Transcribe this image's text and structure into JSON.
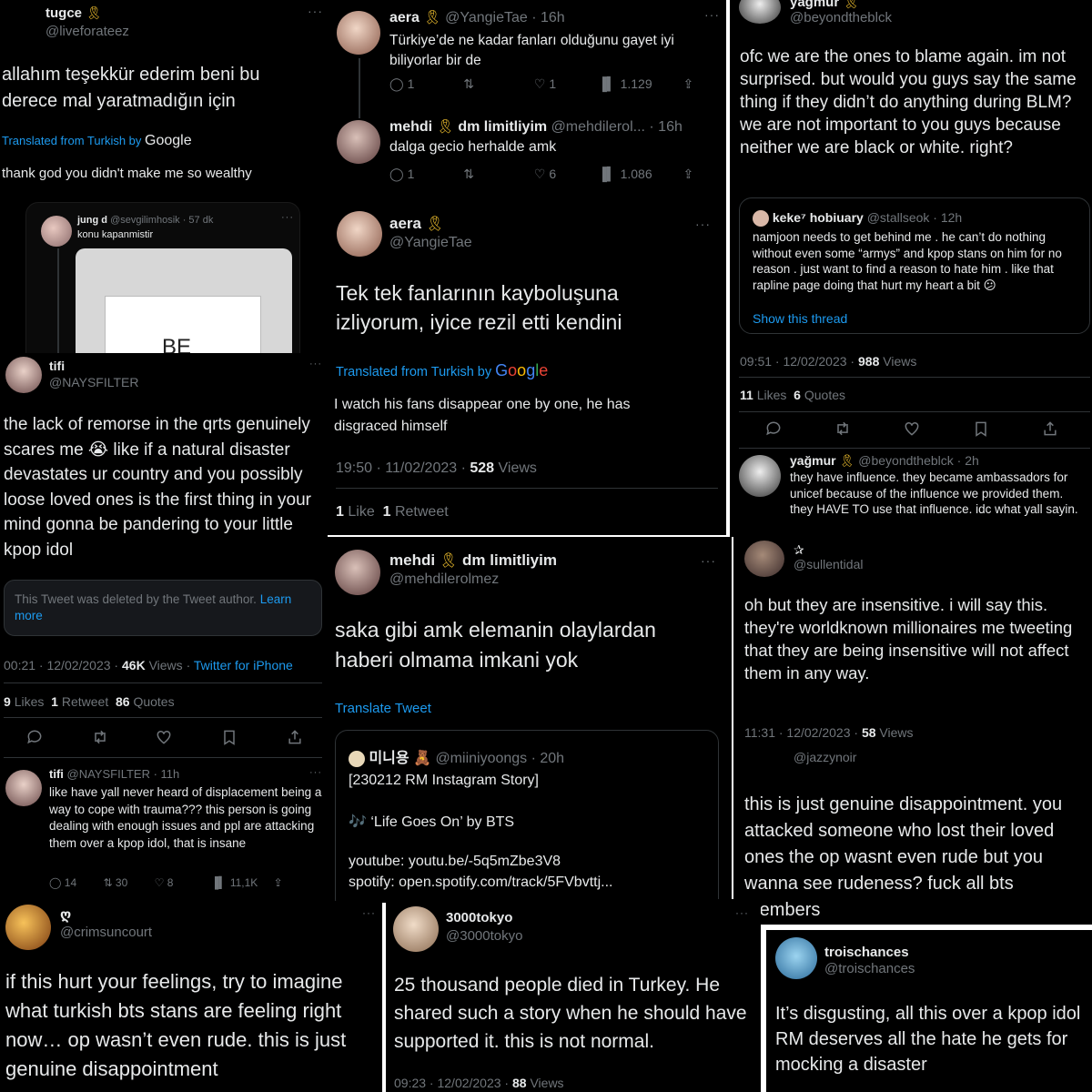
{
  "p1": {
    "name": "tugce",
    "handle": "@liveforateez",
    "text": "allahım teşekkür ederim beni bu derece mal yaratmadığın için",
    "translated_prefix": "Translated from Turkish by",
    "google": "Google",
    "translation": "thank god you didn't make me so wealthy",
    "quote_name": "jung d",
    "quote_handle": "@sevgilimhosik · 57 dk",
    "quote_text": "konu kapanmistir",
    "image_text": "BE"
  },
  "p2": {
    "name": "aera",
    "handle": "@YangieTae · 16h",
    "text": "Türkiye’de ne kadar fanları olduğunu gayet iyi biliyorlar bir de",
    "replies": "1",
    "likes": "1",
    "views": "1.129",
    "reply_name": "mehdi",
    "reply_name_tail": "dm limitliyim",
    "reply_handle": "@mehdilerol... · 16h",
    "reply_text": "dalga gecio herhalde amk",
    "reply_replies": "1",
    "reply_likes": "6",
    "reply_views": "1.086",
    "main_name": "aera",
    "main_handle": "@YangieTae",
    "main_text": "Tek tek fanlarının kayboluşuna izliyorum, iyice rezil etti kendini",
    "translated_prefix": "Translated from Turkish by",
    "google": "Google",
    "translation": "I watch his fans disappear one by one, he has disgraced himself",
    "time": "19:50 · 11/02/2023 · ",
    "views_count": "528",
    "views_label": "Views",
    "like_count": "1",
    "like_label": "Like",
    "rt_count": "1",
    "rt_label": "Retweet"
  },
  "p3": {
    "name": "yagmur",
    "handle": "@beyondtheblck",
    "text": "ofc we are the ones to blame again. im not surprised. but would you guys say the same thing if they didn’t do anything during BLM? we are not important to you guys because neither we are black or white. right?",
    "quote_name": "keke⁷ hobiuary",
    "quote_handle": "@stallseok · 12h",
    "quote_text": "namjoon needs to get behind me . he can’t do nothing without even some “armys” and kpop stans on him for no reason . just want to find a reason to hate him . like that rapline page doing that hurt my heart a bit 😕",
    "show_thread": "Show this thread",
    "time": "09:51 · 12/02/2023 · ",
    "views_count": "988",
    "views_label": "Views",
    "likes_count": "11",
    "likes_label": "Likes",
    "quotes_count": "6",
    "quotes_label": "Quotes",
    "reply_name": "yağmur",
    "reply_handle": "@beyondtheblck · 2h",
    "reply_text": "they have influence. they became ambassadors for unicef because of the influence we provided them. they HAVE TO use that influence. idc what yall sayin."
  },
  "p4": {
    "name": "tifi",
    "handle": "@NAYSFILTER",
    "text": "the lack of remorse in the qrts genuinely scares me 😭 like if a natural disaster devastates ur country and you possibly loose loved ones is the first thing in your mind gonna be pandering to your little kpop idol",
    "deleted": "This Tweet was deleted by the Tweet author.",
    "learn_more": "Learn more",
    "time": "00:21 · 12/02/2023 · ",
    "views_count": "46K",
    "views_label": "Views",
    "source": "Twitter for iPhone",
    "likes_count": "9",
    "likes_label": "Likes",
    "rt_count": "1",
    "rt_label": "Retweet",
    "quotes_count": "86",
    "quotes_label": "Quotes",
    "reply_name": "tifi",
    "reply_handle": "@NAYSFILTER · 11h",
    "reply_text": "like have yall never heard of displacement being a way to cope with trauma??? this person is going dealing with enough issues and ppl are attacking them over a kpop idol, that is insane",
    "r_replies": "14",
    "r_rts": "30",
    "r_likes": "8",
    "r_views": "11,1K"
  },
  "p5": {
    "name": "mehdi",
    "name_tail": "dm limitliyim",
    "handle": "@mehdilerolmez",
    "text": "saka gibi amk elemanin olaylardan haberi olmama imkani yok",
    "translate": "Translate Tweet",
    "quote_name": "미니용 🧸",
    "quote_handle": "@miiniyoongs · 20h",
    "quote_line1": "[230212 RM Instagram Story]",
    "quote_line2": "🎶 ‘Life Goes On’ by BTS",
    "quote_line3": "youtube: youtu.be/-5q5mZbe3V8",
    "quote_line4": "spotify: open.spotify.com/track/5FVbvttj..."
  },
  "p6": {
    "name": "✰",
    "handle": "@sullentidal",
    "text": "oh but they are insensitive. i will say this. they're worldknown millionaires me tweeting that they are being insensitive will not affect them in any way.",
    "time": "11:31 · 12/02/2023 · ",
    "views_count": "58",
    "views_label": "Views"
  },
  "p7": {
    "handle": "@jazzynoir",
    "text": "this is just genuine disappointment. you attacked someone who lost their loved ones the op wasnt even rude but you wanna see rudeness? fuck all bts members"
  },
  "p8": {
    "name": "ღ",
    "handle": "@crimsuncourt",
    "text": "if this hurt your feelings, try to imagine what turkish bts stans are feeling right now… op wasn’t even rude. this is just genuine disappointment"
  },
  "p9": {
    "name": "3000tokyo",
    "handle": "@3000tokyo",
    "text": "25 thousand people died in Turkey. He shared such a story when he should have supported it. this is not normal.",
    "time": "09:23 · 12/02/2023 · ",
    "views_count": "88",
    "views_label": "Views"
  },
  "p10": {
    "name": "troischances",
    "handle": "@troischances",
    "text": "It’s disgusting, all this over a kpop idol RM deserves all the hate he gets for mocking a disaster"
  },
  "colors": {
    "background": "#000000",
    "text": "#e7e9ea",
    "secondary": "#71767b",
    "link": "#1d9bf0",
    "ribbon": "#f2c12e"
  },
  "icons": [
    "reply-icon",
    "retweet-icon",
    "like-icon",
    "views-icon",
    "share-icon",
    "bookmark-icon",
    "more-icon",
    "ribbon-icon",
    "google-logo"
  ]
}
